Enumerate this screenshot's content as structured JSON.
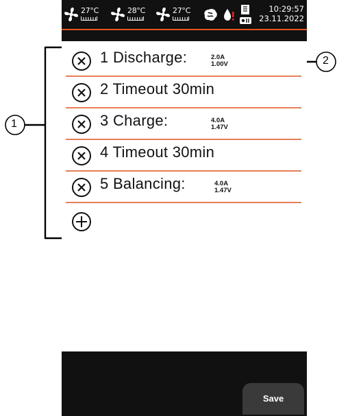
{
  "status": {
    "fans": [
      {
        "icon": "fan-icon",
        "temp": "27°C"
      },
      {
        "icon": "fan-icon",
        "temp": "28°C"
      },
      {
        "icon": "fan-icon",
        "temp": "27°C"
      }
    ],
    "icons": [
      "brain-icon",
      "drop-alert-icon",
      "battery-status-icon"
    ],
    "time": "10:29:57",
    "date": "23.11.2022"
  },
  "steps": [
    {
      "label": "1  Discharge:",
      "values": [
        "2.0A",
        "1.00V"
      ]
    },
    {
      "label": "2  Timeout 30min",
      "values": []
    },
    {
      "label": "3  Charge:",
      "values": [
        "4.0A",
        "1.47V"
      ]
    },
    {
      "label": "4  Timeout 30min",
      "values": []
    },
    {
      "label": "5  Balancing:",
      "values": [
        "4.0A",
        "1.47V"
      ]
    }
  ],
  "buttons": {
    "save": "Save"
  },
  "callouts": [
    "1",
    "2"
  ],
  "colors": {
    "accent": "#e8541d",
    "divider": "#e57e56",
    "bar": "#111111"
  }
}
